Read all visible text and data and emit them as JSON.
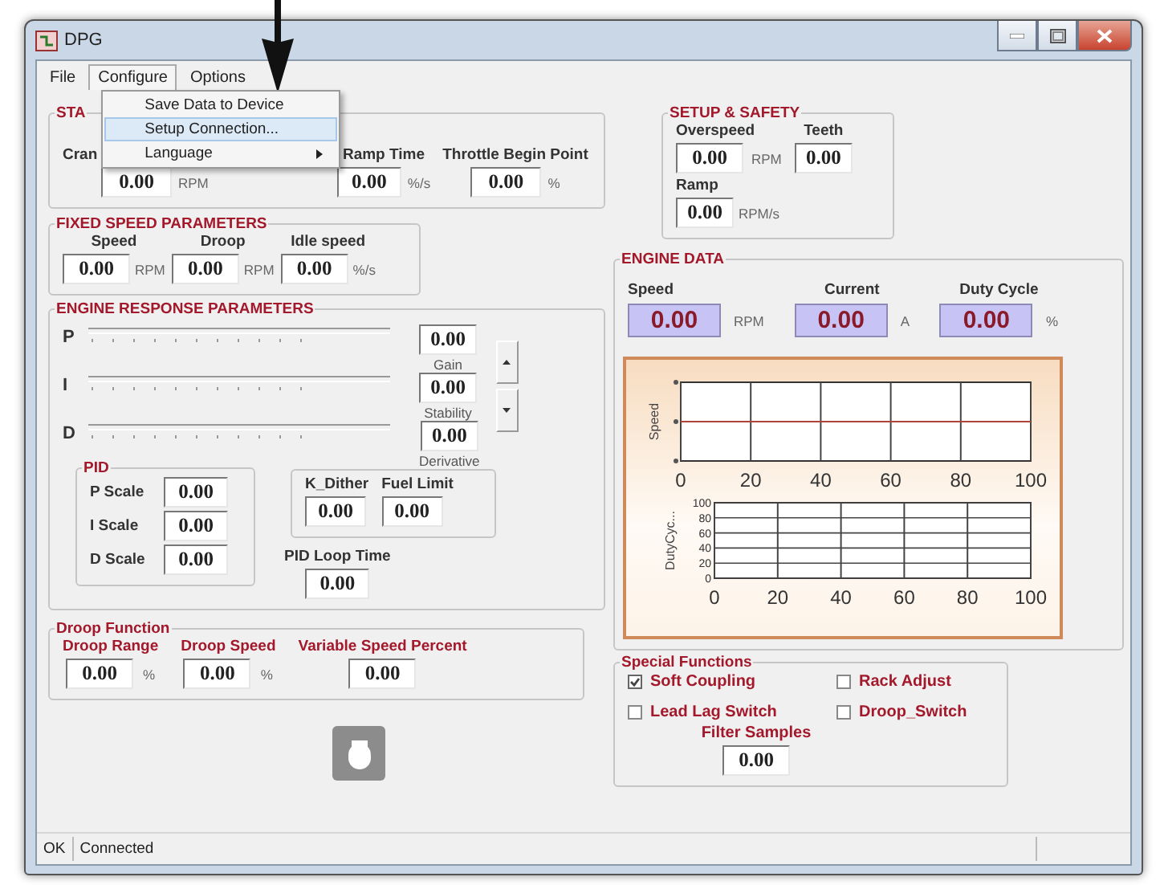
{
  "window": {
    "title": "DPG"
  },
  "menu": [
    {
      "label": "File",
      "selected": false
    },
    {
      "label": "Configure",
      "selected": true
    },
    {
      "label": "Options",
      "selected": false
    }
  ],
  "dropdown": [
    {
      "label": "Save Data to Device",
      "selected": false,
      "submenu": false
    },
    {
      "label": "Setup Connection...",
      "selected": true,
      "submenu": false
    },
    {
      "label": "Language",
      "selected": false,
      "submenu": true
    }
  ],
  "starting": {
    "title": "STA",
    "fields": [
      {
        "label": "Cran",
        "value": "0.00",
        "unit": "RPM"
      },
      {
        "label": "Ramp Time",
        "value": "0.00",
        "unit": "%/s"
      },
      {
        "label": "Throttle Begin Point",
        "value": "0.00",
        "unit": "%"
      }
    ]
  },
  "fixed_speed": {
    "title": "FIXED SPEED PARAMETERS",
    "fields": [
      {
        "label": "Speed",
        "value": "0.00",
        "unit": "RPM"
      },
      {
        "label": "Droop",
        "value": "0.00",
        "unit": "RPM"
      },
      {
        "label": "Idle speed",
        "value": "0.00",
        "unit": "%/s"
      }
    ]
  },
  "engine_response": {
    "title": "ENGINE RESPONSE PARAMETERS",
    "sliders": [
      {
        "label": "P",
        "value": "0.00",
        "caption": "Gain",
        "level": 0
      },
      {
        "label": "I",
        "value": "0.00",
        "caption": "Stability",
        "level": 0
      },
      {
        "label": "D",
        "value": "0.00",
        "caption": "Derivative",
        "level": 0
      }
    ],
    "pid": {
      "title": "PID",
      "fields": [
        {
          "label": "P Scale",
          "value": "0.00"
        },
        {
          "label": "I Scale",
          "value": "0.00"
        },
        {
          "label": "D Scale",
          "value": "0.00"
        }
      ]
    },
    "dither": [
      {
        "label": "K_Dither",
        "value": "0.00"
      },
      {
        "label": "Fuel Limit",
        "value": "0.00"
      }
    ],
    "loop_time": {
      "label": "PID Loop Time",
      "value": "0.00"
    }
  },
  "droop_function": {
    "title": "Droop Function",
    "fields": [
      {
        "label": "Droop Range",
        "value": "0.00",
        "unit": "%"
      },
      {
        "label": "Droop Speed",
        "value": "0.00",
        "unit": "%"
      },
      {
        "label": "Variable Speed Percent",
        "value": "0.00"
      }
    ]
  },
  "setup_safety": {
    "title": "SETUP & SAFETY",
    "overspeed": {
      "label": "Overspeed",
      "value": "0.00",
      "unit": "RPM"
    },
    "teeth": {
      "label": "Teeth",
      "value": "0.00"
    },
    "ramp": {
      "label": "Ramp",
      "value": "0.00",
      "unit": "RPM/s"
    }
  },
  "engine_data": {
    "title": "ENGINE DATA",
    "readouts": [
      {
        "label": "Speed",
        "value": "0.00",
        "unit": "RPM"
      },
      {
        "label": "Current",
        "value": "0.00",
        "unit": "A"
      },
      {
        "label": "Duty Cycle",
        "value": "0.00",
        "unit": "%"
      }
    ],
    "charts": [
      {
        "kind": "trace",
        "ylabel": "Speed",
        "tick_labels": [
          "0",
          "20",
          "40",
          "60",
          "80",
          "100"
        ]
      },
      {
        "chart_data": {
          "type": "line",
          "ylabel": "DutyCyc...",
          "grid": true,
          "xlim": [
            0,
            100
          ],
          "ylim": [
            0,
            100
          ],
          "xticks": [
            0,
            20,
            40,
            60,
            80,
            100
          ],
          "yticks": [
            0,
            20,
            40,
            60,
            80,
            100
          ]
        }
      }
    ]
  },
  "special_functions": {
    "title": "Special Functions",
    "options": [
      {
        "label": "Soft Coupling",
        "checked": true
      },
      {
        "label": "Rack Adjust",
        "checked": false
      },
      {
        "label": "Lead Lag Switch",
        "checked": false
      },
      {
        "label": "Droop_Switch",
        "checked": false
      }
    ],
    "filter_samples": {
      "label": "Filter Samples",
      "value": "0.00"
    }
  },
  "status_bar": [
    "OK",
    "Connected"
  ]
}
